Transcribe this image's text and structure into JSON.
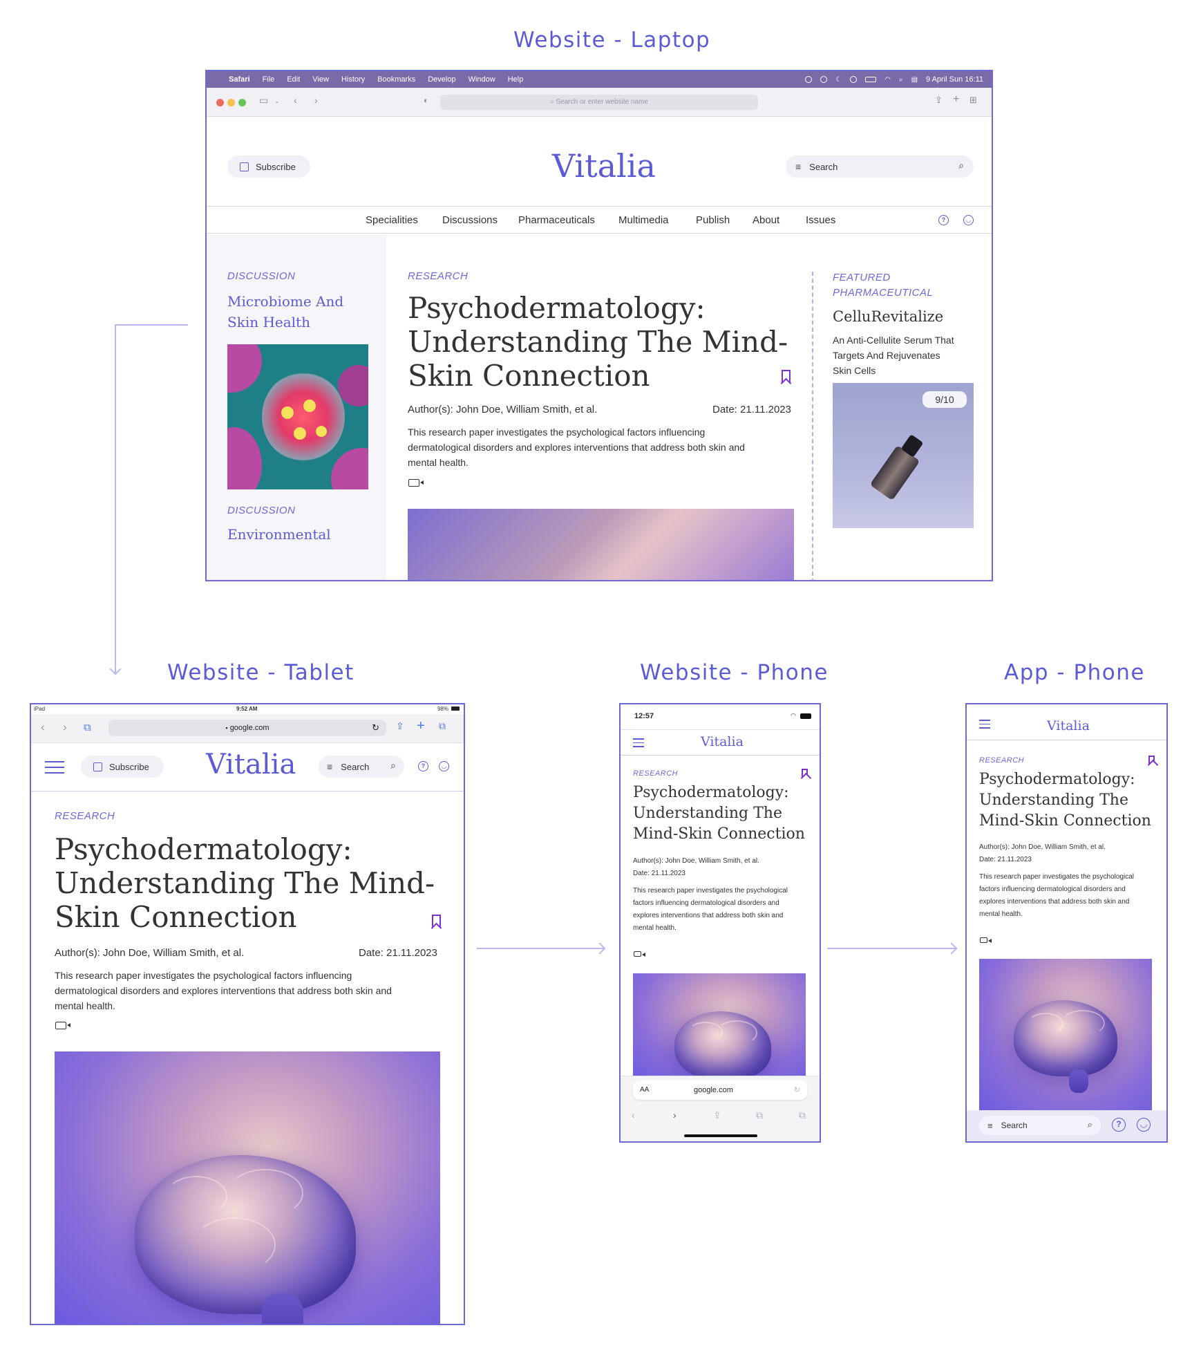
{
  "sections": {
    "laptop": "Website - Laptop",
    "tablet": "Website - Tablet",
    "phone": "Website - Phone",
    "app": "App - Phone"
  },
  "mac_menu": {
    "app": "Safari",
    "items": [
      "File",
      "Edit",
      "View",
      "History",
      "Bookmarks",
      "Develop",
      "Window",
      "Help"
    ],
    "datetime": "9 April Sun  16:11"
  },
  "safari": {
    "placeholder": "Search or enter website name"
  },
  "site": {
    "logo": "Vitalia",
    "subscribe": "Subscribe",
    "search": "Search",
    "nav": [
      "Specialities",
      "Discussions",
      "Pharmaceuticals",
      "Multimedia",
      "Publish",
      "About",
      "Issues"
    ]
  },
  "left_column": {
    "kicker1": "DISCUSSION",
    "title1_line1": "Microbiome And",
    "title1_line2": "Skin Health",
    "kicker2": "DISCUSSION",
    "title2": "Environmental"
  },
  "article": {
    "kicker": "RESEARCH",
    "title_lp": [
      "Psychodermatology:",
      "Understanding The Mind-",
      "Skin Connection"
    ],
    "title_ph": [
      "Psychodermatology:",
      "Understanding The",
      "Mind-Skin Connection"
    ],
    "authors": "Author(s): John Doe, William Smith, et al.",
    "date": "Date: 21.11.2023",
    "summary": "This research paper investigates the psychological factors influencing dermatological disorders and explores interventions that address both skin and mental health.",
    "summary_lines": [
      "This research paper investigates the psychological factors influencing",
      "dermatological disorders and explores interventions that address both skin and",
      "mental health."
    ],
    "summary_phone_lines": [
      "This research paper investigates the psychological",
      "factors influencing dermatological disorders and",
      "explores interventions that address both skin and",
      "mental health."
    ]
  },
  "featured": {
    "kicker_line1": "FEATURED",
    "kicker_line2": "PHARMACEUTICAL",
    "name": "CelluRevitalize",
    "desc_lines": [
      "An Anti-Cellulite Serum That",
      "Targets And Rejuvenates",
      "Skin Cells"
    ],
    "badge": "9/10"
  },
  "tablet": {
    "status_left": "iPad",
    "time": "9:52 AM",
    "battery": "98%",
    "url": "google.com"
  },
  "phone": {
    "time": "12:57",
    "url_prefix": "AA",
    "url": "google.com"
  }
}
